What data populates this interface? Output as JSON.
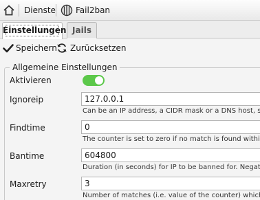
{
  "breadcrumb": {
    "home_icon": "home-icon",
    "items": [
      "Dienste",
      "Fail2ban"
    ],
    "fail2ban_icon": "fail2ban-icon"
  },
  "tabs": [
    {
      "label": "Einstellungen",
      "active": true
    },
    {
      "label": "Jails",
      "active": false
    }
  ],
  "toolbar": {
    "save_label": "Speichern",
    "save_icon": "checkmark-icon",
    "reset_label": "Zurücksetzen",
    "reset_icon": "refresh-icon"
  },
  "form": {
    "legend": "Allgemeine Einstellungen",
    "enable": {
      "label": "Aktivieren",
      "value": true,
      "color": "#5cc84a"
    },
    "fields": [
      {
        "label": "Ignoreip",
        "value": "127.0.0.1",
        "help": "Can be an IP address, a CIDR mask or a DNS host, se"
      },
      {
        "label": "Findtime",
        "value": "0",
        "help": "The counter is set to zero if no match is found within 'f"
      },
      {
        "label": "Bantime",
        "value": "604800",
        "help": "Duration (in seconds) for IP to be banned for. Negativ"
      },
      {
        "label": "Maxretry",
        "value": "3",
        "help": "Number of matches (i.e. value of the counter) which t"
      }
    ]
  }
}
